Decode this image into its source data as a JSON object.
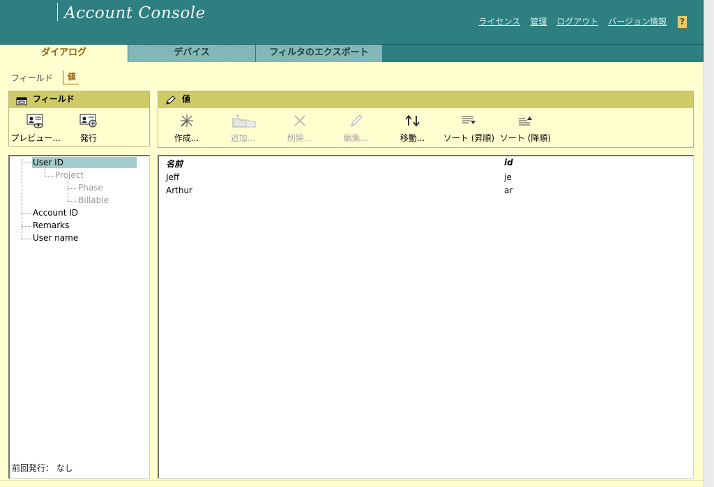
{
  "header": {
    "title": "Account Console",
    "links": [
      {
        "label": "ライセンス"
      },
      {
        "label": "管理"
      },
      {
        "label": "ログアウト"
      },
      {
        "label": "バージョン情報"
      }
    ],
    "help_label": "?"
  },
  "tabs": [
    {
      "label": "ダイアログ",
      "active": true
    },
    {
      "label": "デバイス",
      "active": false
    },
    {
      "label": "フィルタのエクスポート",
      "active": false
    }
  ],
  "breadcrumb": {
    "item": "フィールド",
    "current": "値"
  },
  "fields_panel": {
    "title": "フィールド",
    "buttons": [
      {
        "label": "プレビュー...",
        "icon": "preview-icon"
      },
      {
        "label": "発行",
        "icon": "publish-icon"
      }
    ]
  },
  "values_panel": {
    "title": "値",
    "buttons": [
      {
        "label": "作成...",
        "icon": "create-icon",
        "enabled": true
      },
      {
        "label": "追加...",
        "icon": "add-icon",
        "enabled": false
      },
      {
        "label": "削除...",
        "icon": "delete-icon",
        "enabled": false
      },
      {
        "label": "編集...",
        "icon": "edit-icon",
        "enabled": false
      },
      {
        "label": "移動...",
        "icon": "move-icon",
        "enabled": true
      },
      {
        "label": "ソート (昇順)",
        "icon": "sort-ascending-icon",
        "enabled": true
      },
      {
        "label": "ソート (降順)",
        "icon": "sort-descending-icon",
        "enabled": true
      }
    ]
  },
  "tree": {
    "nodes": [
      {
        "label": "User ID",
        "selected": true,
        "enabled": true
      },
      {
        "label": "Project",
        "selected": false,
        "enabled": false
      },
      {
        "label": "Phase",
        "selected": false,
        "enabled": false
      },
      {
        "label": "Billable",
        "selected": false,
        "enabled": false
      },
      {
        "label": "Account ID",
        "selected": false,
        "enabled": true
      },
      {
        "label": "Remarks",
        "selected": false,
        "enabled": true
      },
      {
        "label": "User name",
        "selected": false,
        "enabled": true
      }
    ],
    "last_publish": "前回発行： なし"
  },
  "table": {
    "columns": [
      "名前",
      "id"
    ],
    "rows": [
      [
        "Jeff",
        "je"
      ],
      [
        "Arthur",
        "ar"
      ]
    ]
  },
  "colors": {
    "header_bg": "#2d7f80",
    "page_bg": "#ffffd0",
    "panel_head": "#cfcb68",
    "accent": "#9a5a00",
    "selection": "#a3cccc"
  }
}
